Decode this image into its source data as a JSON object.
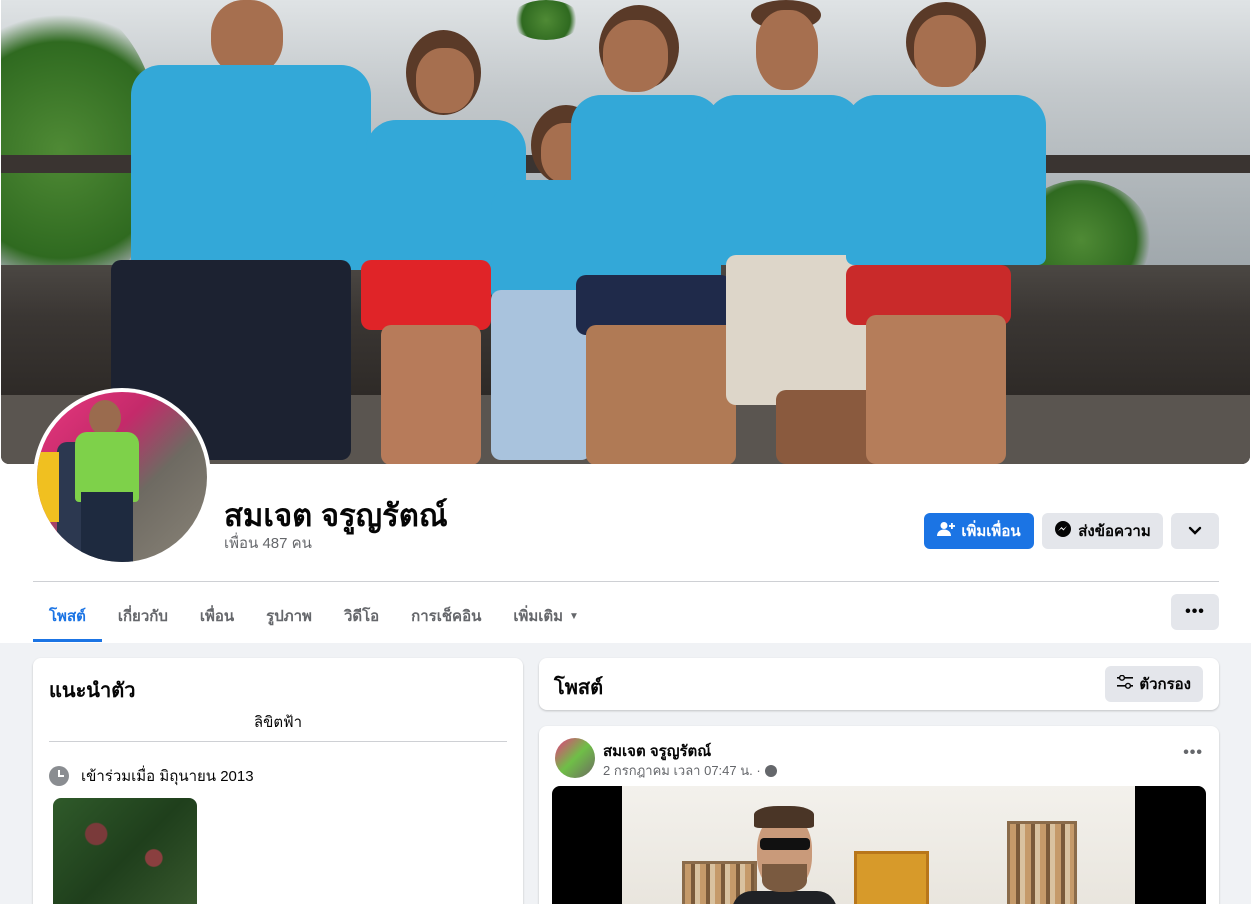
{
  "profile": {
    "name": "สมเจต จรูญรัตณ์",
    "friends": "เพื่อน 487 คน"
  },
  "actions": {
    "add_friend": "เพิ่มเพื่อน",
    "message": "ส่งข้อความ",
    "more_icon": "chevron-down-icon"
  },
  "tabs": [
    {
      "label": "โพสต์",
      "active": true
    },
    {
      "label": "เกี่ยวกับ",
      "active": false
    },
    {
      "label": "เพื่อน",
      "active": false
    },
    {
      "label": "รูปภาพ",
      "active": false
    },
    {
      "label": "วิดีโอ",
      "active": false
    },
    {
      "label": "การเช็คอิน",
      "active": false
    },
    {
      "label": "เพิ่มเติม",
      "active": false
    }
  ],
  "intro": {
    "title": "แนะนำตัว",
    "bio": "ลิขิตฟ้า",
    "joined": "เข้าร่วมเมื่อ มิถุนายน 2013"
  },
  "posts_header": {
    "title": "โพสต์",
    "filter": "ตัวกรอง"
  },
  "post": {
    "author": "สมเจต จรูญรัตณ์",
    "time": "2 กรกฎาคม เวลา 07:47 น. ·"
  },
  "colors": {
    "accent": "#1b74e4",
    "background": "#f0f2f5",
    "secondary_text": "#65676b"
  }
}
